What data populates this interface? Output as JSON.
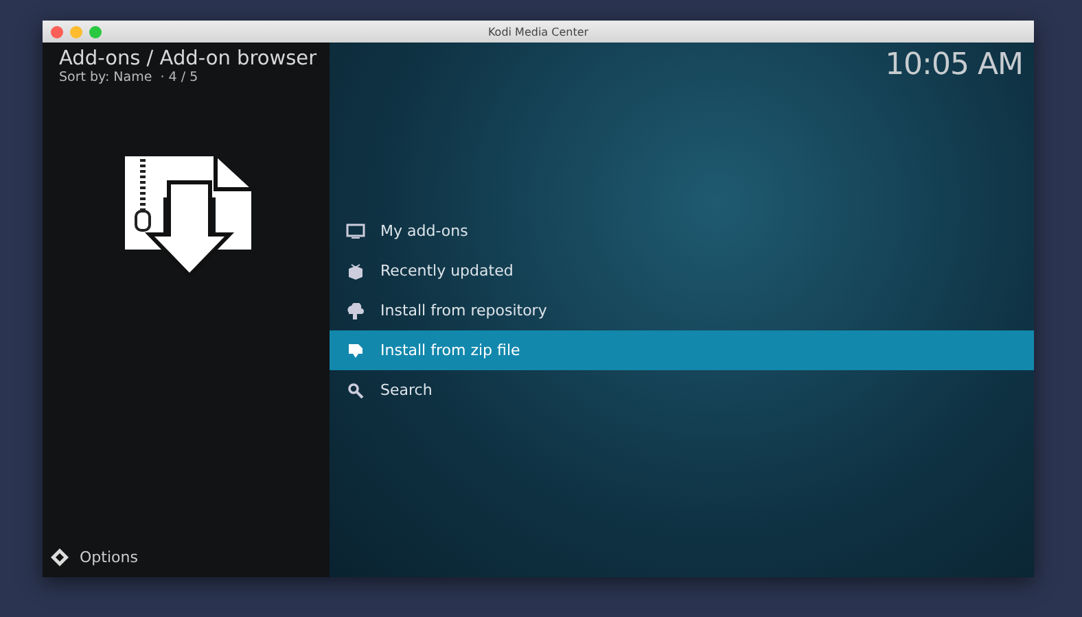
{
  "window": {
    "title": "Kodi Media Center"
  },
  "header": {
    "breadcrumb": "Add-ons / Add-on browser",
    "sort_info": "Sort by: Name  · 4 / 5",
    "clock": "10:05 AM"
  },
  "menu": [
    {
      "label": "My add-ons",
      "selected": false
    },
    {
      "label": "Recently updated",
      "selected": false
    },
    {
      "label": "Install from repository",
      "selected": false
    },
    {
      "label": "Install from zip file",
      "selected": true
    },
    {
      "label": "Search",
      "selected": false
    }
  ],
  "footer": {
    "options": "Options"
  }
}
